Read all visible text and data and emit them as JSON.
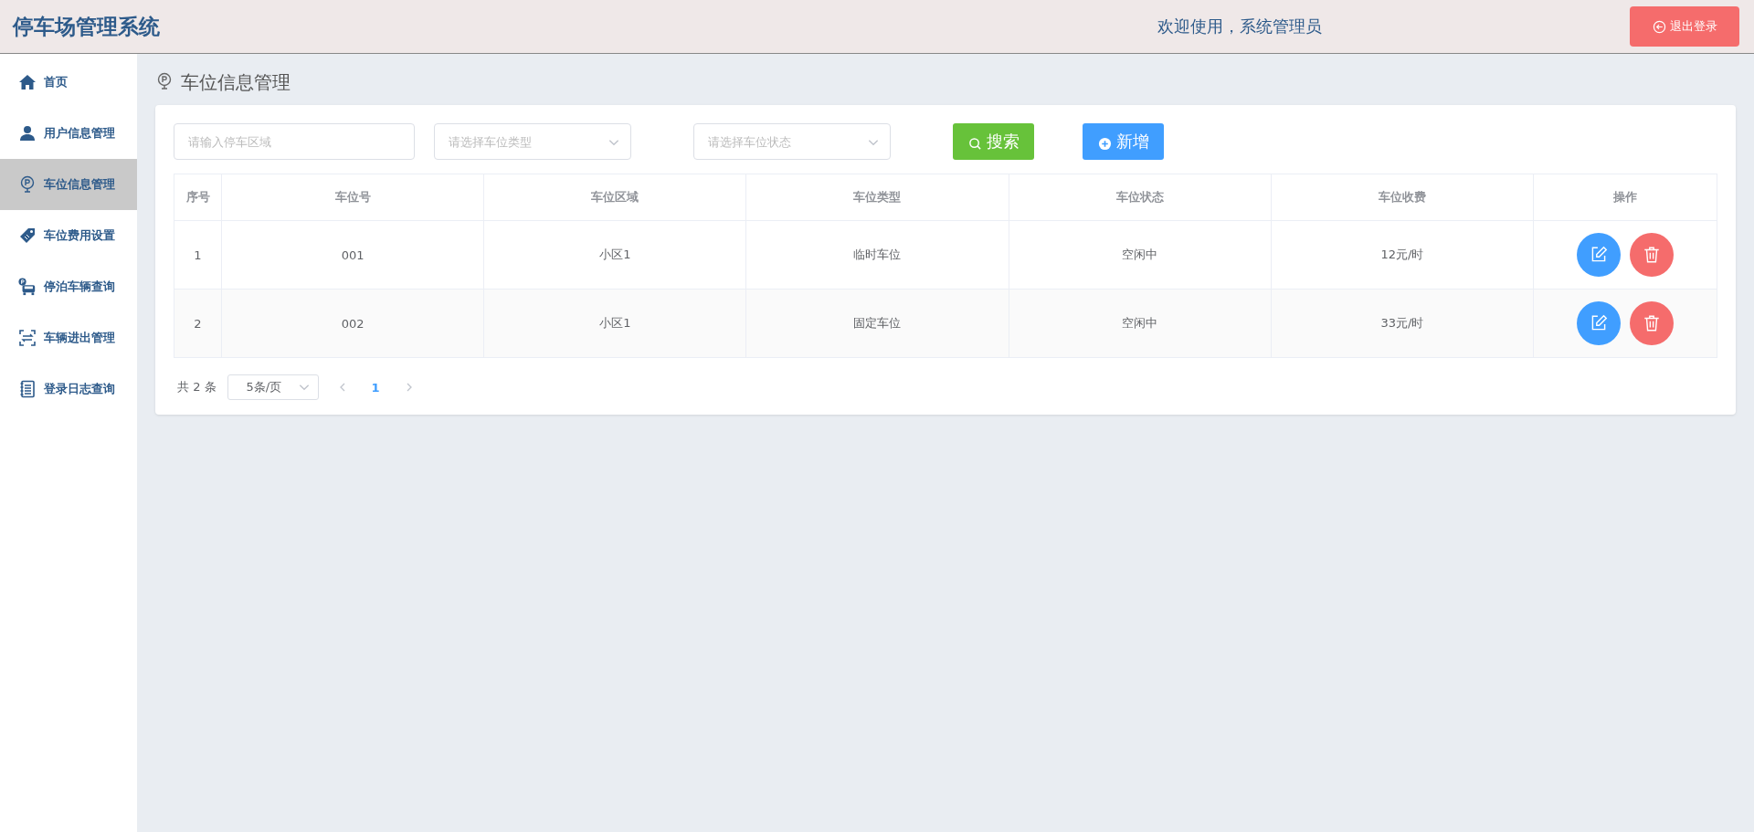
{
  "header": {
    "title": "停车场管理系统",
    "welcome": "欢迎使用，系统管理员",
    "logout": "退出登录"
  },
  "sidebar": {
    "items": [
      {
        "label": "首页",
        "selected": false
      },
      {
        "label": "用户信息管理",
        "selected": false
      },
      {
        "label": "车位信息管理",
        "selected": true
      },
      {
        "label": "车位费用设置",
        "selected": false
      },
      {
        "label": "停泊车辆查询",
        "selected": false
      },
      {
        "label": "车辆进出管理",
        "selected": false
      },
      {
        "label": "登录日志查询",
        "selected": false
      }
    ]
  },
  "page_title": "车位信息管理",
  "filters": {
    "area": {
      "placeholder": "请输入停车区域"
    },
    "type": {
      "placeholder": "请选择车位类型"
    },
    "status": {
      "placeholder": "请选择车位状态"
    },
    "search_button": "搜索",
    "add_button": "新增"
  },
  "table": {
    "columns": [
      "序号",
      "车位号",
      "车位区域",
      "车位类型",
      "车位状态",
      "车位收费",
      "操作"
    ],
    "rows": [
      [
        "1",
        "001",
        "小区1",
        "临时车位",
        "空闲中",
        "12元/时"
      ],
      [
        "2",
        "002",
        "小区1",
        "固定车位",
        "空闲中",
        "33元/时"
      ]
    ]
  },
  "pagination": {
    "total": "共 2 条",
    "page_size": "5条/页",
    "pages": [
      {
        "label": "1",
        "selected": true
      }
    ]
  }
}
